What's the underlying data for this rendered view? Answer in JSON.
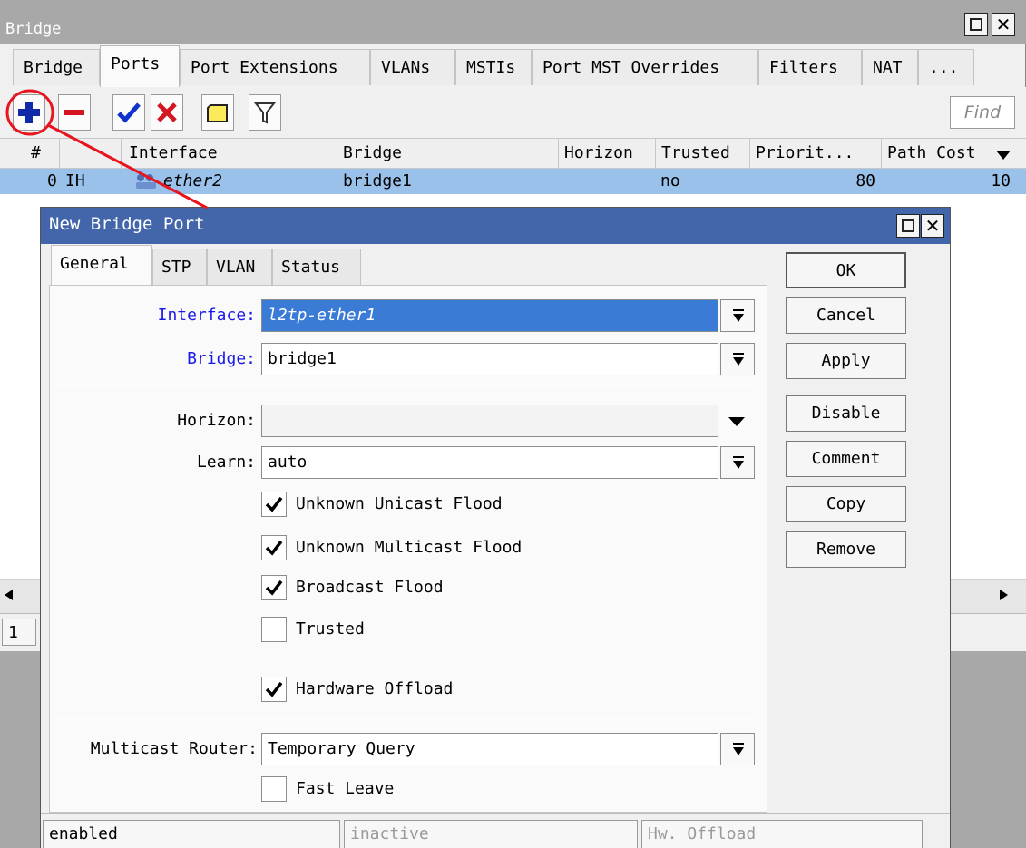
{
  "window": {
    "title": "Bridge",
    "tabs": [
      "Bridge",
      "Ports",
      "Port Extensions",
      "VLANs",
      "MSTIs",
      "Port MST Overrides",
      "Filters",
      "NAT",
      "..."
    ],
    "active_tab": "Ports",
    "find_placeholder": "Find"
  },
  "toolbar": {
    "icons": [
      "add-icon",
      "remove-icon",
      "enable-check-icon",
      "disable-x-icon",
      "comment-icon",
      "filter-icon"
    ]
  },
  "grid": {
    "columns": [
      "#",
      "Interface",
      "Bridge",
      "Horizon",
      "Trusted",
      "Priorit...",
      "Path Cost"
    ],
    "rows": [
      {
        "num": "0",
        "flags": "IH",
        "interface": "ether2",
        "bridge": "bridge1",
        "horizon": "",
        "trusted": "no",
        "priority": "80",
        "path_cost": "10"
      }
    ],
    "count": "1"
  },
  "dialog": {
    "title": "New Bridge Port",
    "tabs": [
      "General",
      "STP",
      "VLAN",
      "Status"
    ],
    "active_tab": "General",
    "labels": {
      "interface": "Interface:",
      "bridge": "Bridge:",
      "horizon": "Horizon:",
      "learn": "Learn:",
      "multicast_router": "Multicast Router:"
    },
    "values": {
      "interface": "l2tp-ether1",
      "bridge": "bridge1",
      "horizon": "",
      "learn": "auto",
      "multicast_router": "Temporary Query"
    },
    "checkboxes": [
      {
        "label": "Unknown Unicast Flood",
        "checked": true
      },
      {
        "label": "Unknown Multicast Flood",
        "checked": true
      },
      {
        "label": "Broadcast Flood",
        "checked": true
      },
      {
        "label": "Trusted",
        "checked": false
      },
      {
        "label": "Hardware Offload",
        "checked": true
      },
      {
        "label": "Fast Leave",
        "checked": false
      }
    ],
    "buttons": [
      "OK",
      "Cancel",
      "Apply",
      "Disable",
      "Comment",
      "Copy",
      "Remove"
    ],
    "status": [
      "enabled",
      "inactive",
      "Hw. Offload"
    ]
  },
  "colors": {
    "dialog_title_bar": "#4266a9",
    "selected_row": "#99c1ea",
    "annotation_red": "#e8141e",
    "field_label_blue": "#1a1ae8"
  }
}
